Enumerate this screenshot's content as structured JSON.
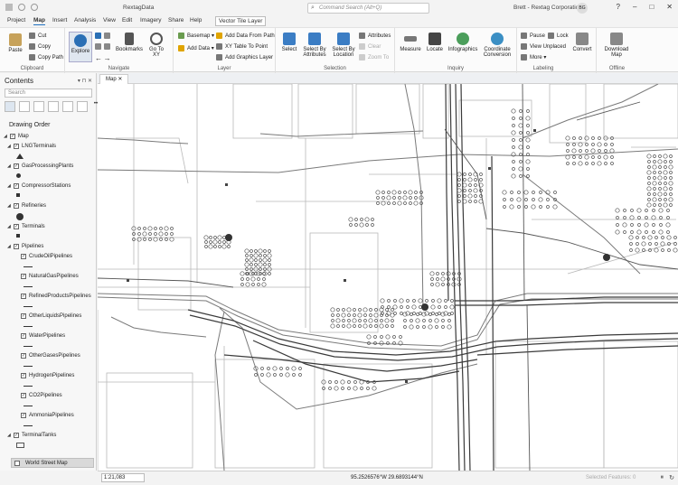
{
  "titlebar": {
    "doc_title": "RextagData",
    "search_placeholder": "Command Search (Alt+Q)",
    "user": "Brett - Rextag Corporation",
    "initials": "BG"
  },
  "tabs": [
    "Project",
    "Map",
    "Insert",
    "Analysis",
    "View",
    "Edit",
    "Imagery",
    "Share",
    "Help"
  ],
  "active_tab": "Map",
  "context_tab": "Vector Tile Layer",
  "ribbon": {
    "clipboard": {
      "label": "Clipboard",
      "paste": "Paste",
      "cut": "Cut",
      "copy": "Copy",
      "copy_path": "Copy Path"
    },
    "navigate": {
      "label": "Navigate",
      "explore": "Explore",
      "bookmarks": "Bookmarks",
      "goto": "Go To XY"
    },
    "layer": {
      "label": "Layer",
      "basemap": "Basemap",
      "add_data": "Add Data",
      "add_from_path": "Add Data From Path",
      "xy_table": "XY Table To Point",
      "add_graphics": "Add Graphics Layer"
    },
    "selection": {
      "label": "Selection",
      "select": "Select",
      "select_by_attr": "Select By Attributes",
      "select_by_loc": "Select By Location",
      "attributes": "Attributes",
      "clear": "Clear",
      "zoom_to": "Zoom To"
    },
    "inquiry": {
      "label": "Inquiry",
      "measure": "Measure",
      "locate": "Locate",
      "infographics": "Infographics",
      "coord_conv": "Coordinate Conversion"
    },
    "labeling": {
      "label": "Labeling",
      "pause": "Pause",
      "lock": "Lock",
      "view_unplaced": "View Unplaced",
      "more": "More"
    },
    "offline": {
      "label": "Offline",
      "convert": "Convert",
      "download_map": "Download Map"
    }
  },
  "contents": {
    "title": "Contents",
    "search_placeholder": "Search",
    "drawing_order": "Drawing Order",
    "layers": [
      {
        "name": "Map",
        "level": 0,
        "symbol": "map"
      },
      {
        "name": "LNGTerminals",
        "level": 1,
        "symbol": "triangle"
      },
      {
        "name": "GasProcessingPlants",
        "level": 1,
        "symbol": "dot"
      },
      {
        "name": "CompressorStations",
        "level": 1,
        "symbol": "square"
      },
      {
        "name": "Refineries",
        "level": 1,
        "symbol": "bigdot"
      },
      {
        "name": "Terminals",
        "level": 1,
        "symbol": "square"
      },
      {
        "name": "Pipelines",
        "level": 1,
        "symbol": "none"
      },
      {
        "name": "CrudeOilPipelines",
        "level": 2,
        "symbol": "line"
      },
      {
        "name": "NaturalGasPipelines",
        "level": 2,
        "symbol": "line"
      },
      {
        "name": "RefinedProductsPipelines",
        "level": 2,
        "symbol": "line"
      },
      {
        "name": "OtherLiquidsPipelines",
        "level": 2,
        "symbol": "line"
      },
      {
        "name": "WaterPipelines",
        "level": 2,
        "symbol": "line"
      },
      {
        "name": "OtherGasesPipelines",
        "level": 2,
        "symbol": "line"
      },
      {
        "name": "HydrogenPipelines",
        "level": 2,
        "symbol": "line"
      },
      {
        "name": "CO2Pipelines",
        "level": 2,
        "symbol": "line"
      },
      {
        "name": "AmmoniaPipelines",
        "level": 2,
        "symbol": "line"
      },
      {
        "name": "TerminalTanks",
        "level": 1,
        "symbol": "rect"
      }
    ],
    "basemap": "World Street Map"
  },
  "map": {
    "tab": "Map",
    "scale": "1:21,083",
    "coordinates": "95.2526576°W 29.6893144°N",
    "selected_features": "Selected Features: 0"
  }
}
